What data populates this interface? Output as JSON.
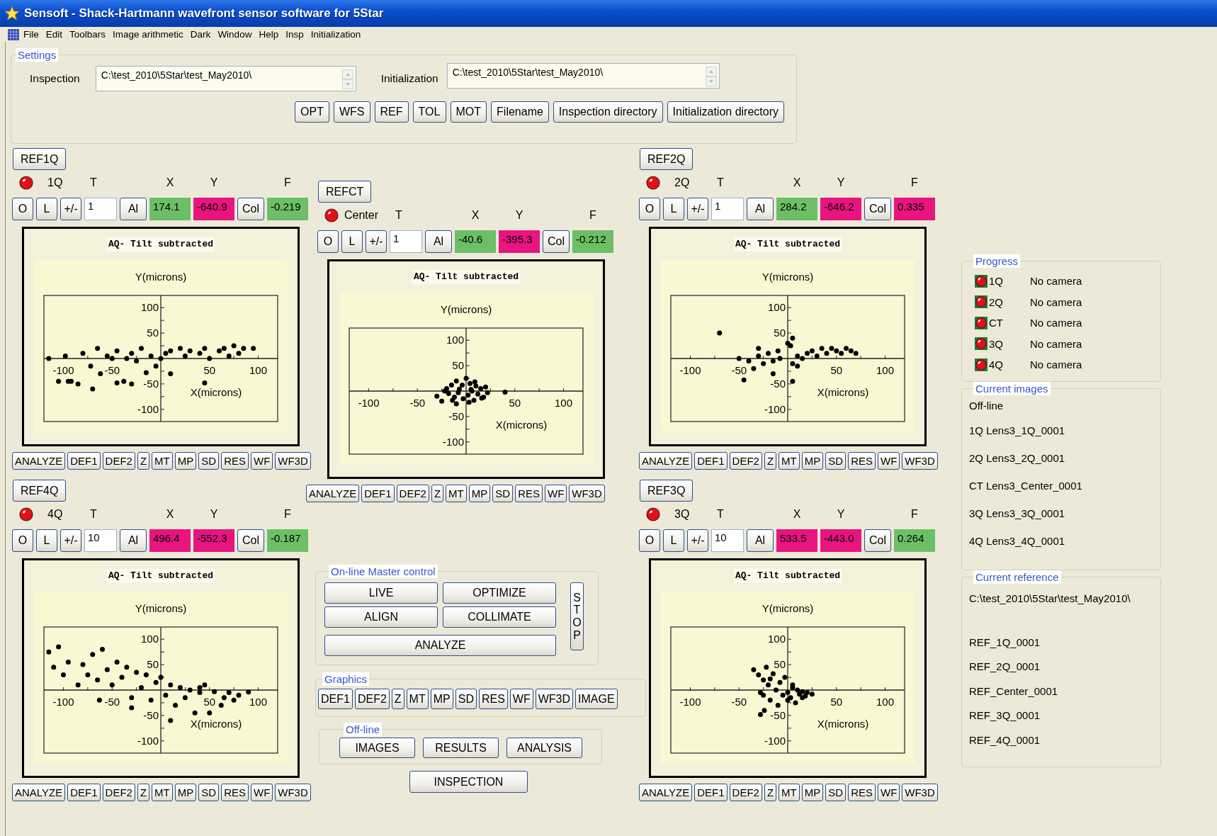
{
  "window": {
    "title": "Sensoft - Shack-Hartmann wavefront sensor software for 5Star"
  },
  "menu": [
    "File",
    "Edit",
    "Toolbars",
    "Image arithmetic",
    "Dark",
    "Window",
    "Help",
    "Insp",
    "Initialization"
  ],
  "settings": {
    "title": "Settings",
    "inspection": {
      "label": "Inspection",
      "value": "C:\\test_2010\\5Star\\test_May2010\\"
    },
    "initialization": {
      "label": "Initialization",
      "value": "C:\\test_2010\\5Star\\test_May2010\\"
    },
    "buttons": [
      "OPT",
      "WFS",
      "REF",
      "TOL",
      "MOT",
      "Filename",
      "Inspection directory",
      "Initialization directory"
    ]
  },
  "panels": [
    {
      "ref_button": "REF1Q",
      "name": "1Q",
      "column_labels": [
        "T",
        "X",
        "Y",
        "F"
      ],
      "buttons": [
        "O",
        "L",
        "+/-"
      ],
      "t_value": "1",
      "align_button": "Al",
      "x": {
        "value": "174.1",
        "color": "#6cbf66"
      },
      "y": {
        "value": "-640.9",
        "color": "#e8147f"
      },
      "col_button": "Col",
      "f": {
        "value": "-0.219",
        "color": "#6cbf66"
      },
      "chart_data": {
        "type": "scatter",
        "title": "AQ- Tilt subtracted",
        "xlabel": "X(microns)",
        "ylabel": "Y(microns)",
        "xlim": [
          -120,
          120
        ],
        "ylim": [
          -124,
          124
        ],
        "xticks": [
          -100,
          -50,
          50,
          100
        ],
        "yticks": [
          -100,
          -50,
          50,
          100
        ],
        "x": [
          -115,
          -105,
          -98,
          -92,
          -85,
          -80,
          -72,
          -65,
          -62,
          -55,
          -50,
          -45,
          -38,
          -35,
          -30,
          -25,
          -20,
          -15,
          -10,
          -5,
          0,
          5,
          10,
          20,
          25,
          30,
          40,
          45,
          50,
          60,
          65,
          70,
          75,
          80,
          85,
          95,
          -95,
          -70,
          -45,
          -30,
          10,
          45
        ],
        "values": [
          0,
          -45,
          5,
          -45,
          -50,
          10,
          -15,
          20,
          -30,
          5,
          0,
          15,
          -45,
          0,
          10,
          -5,
          20,
          -28,
          5,
          -15,
          0,
          10,
          15,
          20,
          5,
          15,
          10,
          20,
          0,
          15,
          20,
          5,
          25,
          10,
          20,
          20,
          -45,
          -60,
          -48,
          -50,
          -30,
          -48
        ]
      },
      "toolbar": [
        "ANALYZE",
        "DEF1",
        "DEF2",
        "Z",
        "MT",
        "MP",
        "SD",
        "RES",
        "WF",
        "WF3D"
      ]
    },
    {
      "ref_button": "REFCT",
      "name": "Center",
      "column_labels": [
        "T",
        "X",
        "Y",
        "F"
      ],
      "buttons": [
        "O",
        "L",
        "+/-"
      ],
      "t_value": "1",
      "align_button": "Al",
      "x": {
        "value": "-40.6",
        "color": "#6cbf66"
      },
      "y": {
        "value": "-395.3",
        "color": "#e8147f"
      },
      "col_button": "Col",
      "f": {
        "value": "-0.212",
        "color": "#6cbf66"
      },
      "chart_data": {
        "type": "scatter",
        "title": "AQ- Tilt subtracted",
        "xlabel": "X(microns)",
        "ylabel": "Y(microns)",
        "xlim": [
          -120,
          120
        ],
        "ylim": [
          -124,
          124
        ],
        "xticks": [
          -100,
          -50,
          50,
          100
        ],
        "yticks": [
          -100,
          -50,
          50,
          100
        ],
        "x": [
          -30,
          -25,
          -20,
          -18,
          -15,
          -12,
          -10,
          -8,
          -4,
          -3,
          0,
          2,
          4,
          6,
          8,
          10,
          12,
          15,
          18,
          20,
          22,
          -22,
          -14,
          -7,
          3,
          9,
          16,
          -10,
          5,
          40
        ],
        "values": [
          -10,
          -20,
          5,
          -5,
          12,
          -12,
          20,
          -3,
          12,
          -15,
          25,
          -8,
          15,
          0,
          -18,
          10,
          -6,
          5,
          -12,
          8,
          -3,
          0,
          -18,
          4,
          -22,
          18,
          -14,
          -25,
          3,
          -2
        ]
      },
      "toolbar": [
        "ANALYZE",
        "DEF1",
        "DEF2",
        "Z",
        "MT",
        "MP",
        "SD",
        "RES",
        "WF",
        "WF3D"
      ]
    },
    {
      "ref_button": "REF2Q",
      "name": "2Q",
      "column_labels": [
        "T",
        "X",
        "Y",
        "F"
      ],
      "buttons": [
        "O",
        "L",
        "+/-"
      ],
      "t_value": "1",
      "align_button": "Al",
      "x": {
        "value": "284.2",
        "color": "#6cbf66"
      },
      "y": {
        "value": "-646.2",
        "color": "#e8147f"
      },
      "col_button": "Col",
      "f": {
        "value": "0.335",
        "color": "#e8147f"
      },
      "chart_data": {
        "type": "scatter",
        "title": "AQ- Tilt subtracted",
        "xlabel": "X(microns)",
        "ylabel": "Y(microns)",
        "xlim": [
          -120,
          120
        ],
        "ylim": [
          -124,
          124
        ],
        "xticks": [
          -100,
          -50,
          50,
          100
        ],
        "yticks": [
          -100,
          -50,
          50,
          100
        ],
        "x": [
          -70,
          -50,
          -45,
          -40,
          -35,
          -30,
          -25,
          -20,
          -15,
          -10,
          -8,
          5,
          0,
          5,
          10,
          15,
          20,
          25,
          30,
          35,
          40,
          45,
          50,
          55,
          60,
          65,
          70,
          -30,
          -15,
          10,
          5,
          3
        ],
        "values": [
          50,
          0,
          -42,
          -5,
          -20,
          5,
          -10,
          10,
          -5,
          15,
          0,
          40,
          30,
          -10,
          5,
          0,
          10,
          15,
          5,
          20,
          10,
          20,
          15,
          10,
          20,
          15,
          10,
          20,
          -30,
          -15,
          -45,
          25
        ]
      },
      "toolbar": [
        "ANALYZE",
        "DEF1",
        "DEF2",
        "Z",
        "MT",
        "MP",
        "SD",
        "RES",
        "WF",
        "WF3D"
      ]
    },
    {
      "ref_button": "REF4Q",
      "name": "4Q",
      "column_labels": [
        "T",
        "X",
        "Y",
        "F"
      ],
      "buttons": [
        "O",
        "L",
        "+/-"
      ],
      "t_value": "10",
      "align_button": "Al",
      "x": {
        "value": "496.4",
        "color": "#e8147f"
      },
      "y": {
        "value": "-552.3",
        "color": "#e8147f"
      },
      "col_button": "Col",
      "f": {
        "value": "-0.187",
        "color": "#6cbf66"
      },
      "chart_data": {
        "type": "scatter",
        "title": "AQ- Tilt subtracted",
        "xlabel": "X(microns)",
        "ylabel": "Y(microns)",
        "xlim": [
          -120,
          120
        ],
        "ylim": [
          -124,
          124
        ],
        "xticks": [
          -100,
          -50,
          50,
          100
        ],
        "yticks": [
          -100,
          -50,
          50,
          100
        ],
        "x": [
          -115,
          -110,
          -105,
          -100,
          -95,
          -85,
          -80,
          -75,
          -70,
          -65,
          -60,
          -55,
          -50,
          -45,
          -40,
          -35,
          -30,
          -25,
          -20,
          -15,
          -10,
          -5,
          0,
          5,
          10,
          15,
          20,
          25,
          30,
          35,
          40,
          45,
          50,
          55,
          62,
          65,
          70,
          75,
          80,
          90,
          -63,
          -30,
          10,
          40
        ],
        "values": [
          75,
          45,
          85,
          30,
          55,
          10,
          50,
          30,
          70,
          20,
          80,
          40,
          10,
          55,
          25,
          45,
          -15,
          35,
          5,
          30,
          -20,
          15,
          25,
          -10,
          10,
          -30,
          5,
          -15,
          0,
          -45,
          -5,
          10,
          -45,
          -3,
          -30,
          -15,
          -5,
          -20,
          -10,
          -4,
          -20,
          -35,
          -60,
          5
        ]
      },
      "toolbar": [
        "ANALYZE",
        "DEF1",
        "DEF2",
        "Z",
        "MT",
        "MP",
        "SD",
        "RES",
        "WF",
        "WF3D"
      ]
    },
    {
      "ref_button": "REF3Q",
      "name": "3Q",
      "column_labels": [
        "T",
        "X",
        "Y",
        "F"
      ],
      "buttons": [
        "O",
        "L",
        "+/-"
      ],
      "t_value": "10",
      "align_button": "Al",
      "x": {
        "value": "533.5",
        "color": "#e8147f"
      },
      "y": {
        "value": "-443.0",
        "color": "#e8147f"
      },
      "col_button": "Col",
      "f": {
        "value": "0.264",
        "color": "#6cbf66"
      },
      "chart_data": {
        "type": "scatter",
        "title": "AQ- Tilt subtracted",
        "xlabel": "X(microns)",
        "ylabel": "Y(microns)",
        "xlim": [
          -120,
          120
        ],
        "ylim": [
          -124,
          124
        ],
        "xticks": [
          -100,
          -50,
          50,
          100
        ],
        "yticks": [
          -100,
          -50,
          50,
          100
        ],
        "x": [
          -35,
          -30,
          -28,
          -25,
          -22,
          -20,
          -18,
          -15,
          -12,
          -10,
          -8,
          -5,
          -3,
          0,
          3,
          5,
          8,
          10,
          12,
          15,
          18,
          20,
          25,
          -24,
          -28,
          0,
          -25,
          -18,
          5,
          15
        ],
        "values": [
          40,
          30,
          -5,
          20,
          45,
          10,
          -20,
          32,
          0,
          -30,
          15,
          -10,
          25,
          -5,
          -15,
          5,
          -25,
          0,
          -8,
          -3,
          -12,
          -5,
          -8,
          -40,
          -48,
          -20,
          -10,
          22,
          10,
          -15
        ]
      },
      "toolbar": [
        "ANALYZE",
        "DEF1",
        "DEF2",
        "Z",
        "MT",
        "MP",
        "SD",
        "RES",
        "WF",
        "WF3D"
      ]
    }
  ],
  "master_control": {
    "title": "On-line Master control",
    "buttons": [
      "LIVE",
      "OPTIMIZE",
      "ALIGN",
      "COLLIMATE",
      "ANALYZE"
    ],
    "stop": "STOP"
  },
  "graphics": {
    "title": "Graphics",
    "buttons": [
      "DEF1",
      "DEF2",
      "Z",
      "MT",
      "MP",
      "SD",
      "RES",
      "WF",
      "WF3D",
      "IMAGE"
    ]
  },
  "offline": {
    "title": "Off-line",
    "buttons": [
      "IMAGES",
      "RESULTS",
      "ANALYSIS"
    ]
  },
  "inspection_button": "INSPECTION",
  "progress": {
    "title": "Progress",
    "rows": [
      {
        "label": "1Q",
        "status": "No camera"
      },
      {
        "label": "2Q",
        "status": "No camera"
      },
      {
        "label": "CT",
        "status": "No camera"
      },
      {
        "label": "3Q",
        "status": "No camera"
      },
      {
        "label": "4Q",
        "status": "No camera"
      }
    ]
  },
  "current_images": {
    "title": "Current images",
    "mode": "Off-line",
    "items": [
      "1Q Lens3_1Q_0001",
      "2Q Lens3_2Q_0001",
      "CT Lens3_Center_0001",
      "3Q Lens3_3Q_0001",
      "4Q Lens3_4Q_0001"
    ]
  },
  "current_reference": {
    "title": "Current reference",
    "path": "C:\\test_2010\\5Star\\test_May2010\\",
    "items": [
      "REF_1Q_0001",
      "REF_2Q_0001",
      "REF_Center_0001",
      "REF_3Q_0001",
      "REF_4Q_0001"
    ]
  }
}
